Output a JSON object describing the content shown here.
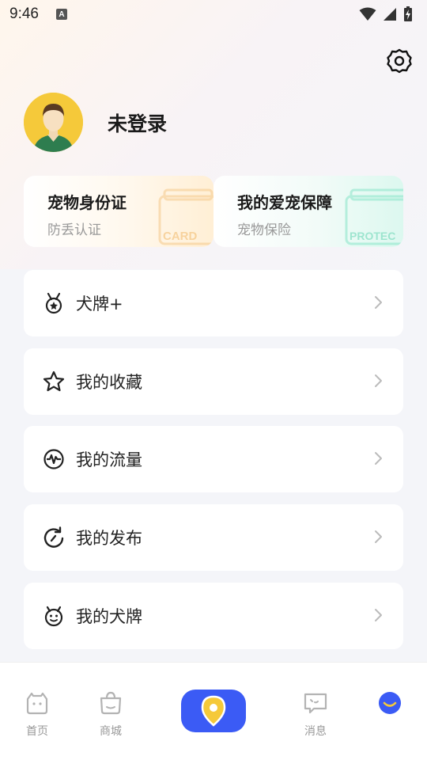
{
  "status_bar": {
    "time": "9:46",
    "notification_badge": "A"
  },
  "profile": {
    "login_status": "未登录"
  },
  "promo_cards": [
    {
      "title": "宠物身份证",
      "subtitle": "防丢认证",
      "deco_text": "CARD"
    },
    {
      "title": "我的爱宠保障",
      "subtitle": "宠物保险",
      "deco_text": "PROTEC"
    }
  ],
  "menu": [
    {
      "label": "犬牌+",
      "icon": "medal-icon"
    },
    {
      "label": "我的收藏",
      "icon": "star-icon"
    },
    {
      "label": "我的流量",
      "icon": "pulse-icon"
    },
    {
      "label": "我的发布",
      "icon": "refresh-icon"
    },
    {
      "label": "我的犬牌",
      "icon": "dog-tag-icon"
    }
  ],
  "tabs": [
    {
      "label": "首页",
      "icon": "home-face-icon"
    },
    {
      "label": "商城",
      "icon": "shopping-bag-icon"
    },
    {
      "label": "",
      "icon": "location-pin-icon"
    },
    {
      "label": "消息",
      "icon": "chat-bubble-icon"
    },
    {
      "label": "",
      "icon": "smile-face-icon"
    }
  ],
  "colors": {
    "accent": "#3b5bf5",
    "avatar_bg": "#f5c93a",
    "pin": "#f5c93a"
  }
}
